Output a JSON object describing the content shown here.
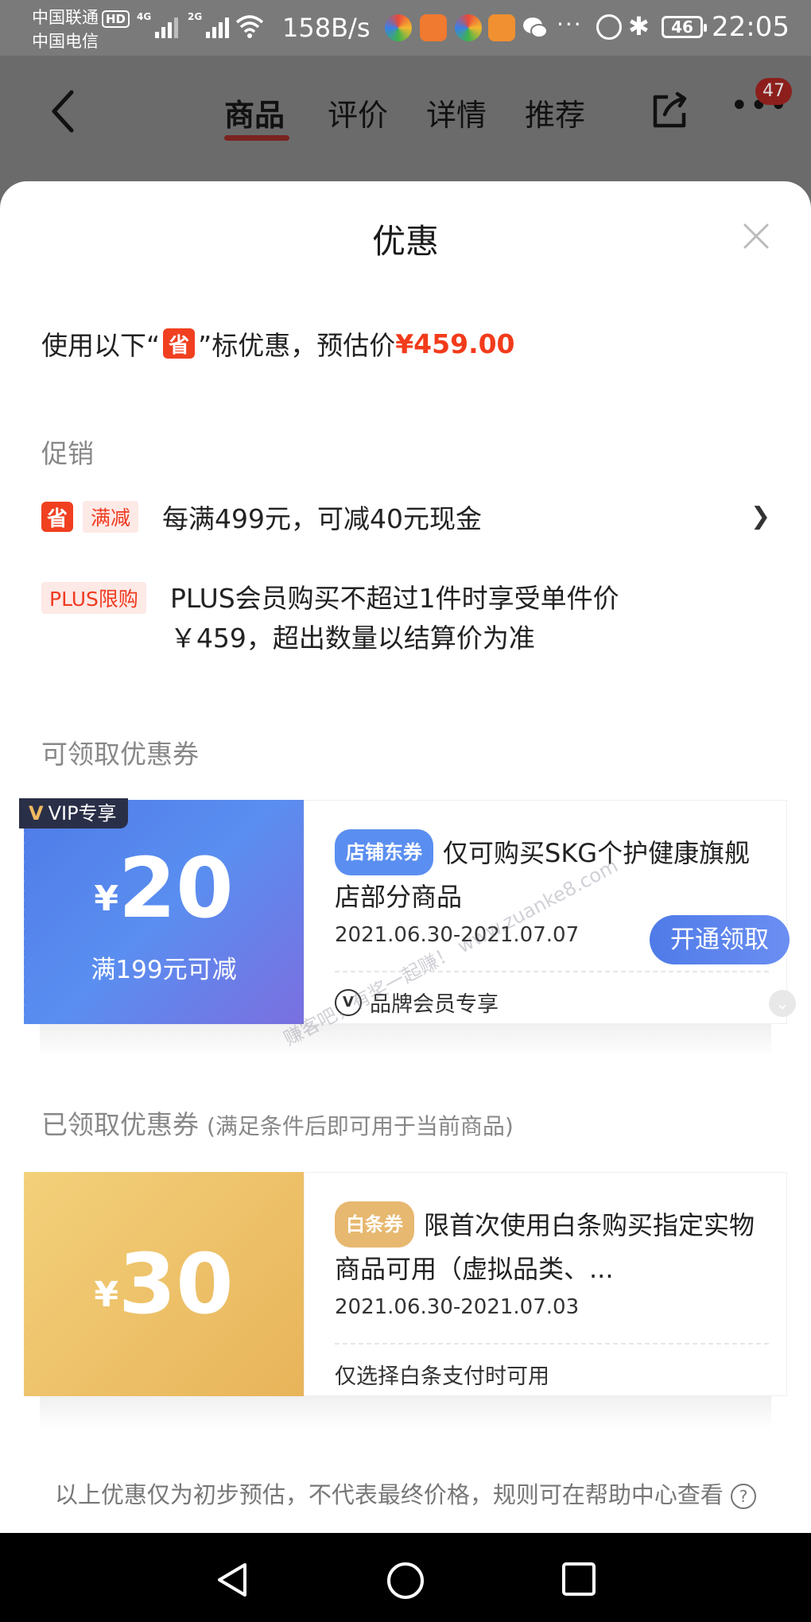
{
  "status_bar": {
    "carrier1": "中国联通",
    "hd": "HD",
    "carrier2": "中国电信",
    "net1": "4G",
    "net2": "2G",
    "speed": "158B/s",
    "battery": "46",
    "time": "22:05"
  },
  "header": {
    "tabs": [
      {
        "label": "商品",
        "active": true
      },
      {
        "label": "评价"
      },
      {
        "label": "详情"
      },
      {
        "label": "推荐"
      }
    ],
    "badge_count": "47"
  },
  "sheet": {
    "title": "优惠",
    "summary": {
      "prefix": "使用以下“",
      "icon_text": "省",
      "suffix": "”标优惠，预估价",
      "price": "¥459.00"
    },
    "promotion_section": "促销",
    "promotions": [
      {
        "icon": "省",
        "tag": "满减",
        "text": "每满499元，可减40元现金"
      },
      {
        "tag": "PLUS限购",
        "text_line1": "PLUS会员购买不超过1件时享受单件价",
        "text_line2": "￥459，超出数量以结算价为准"
      }
    ],
    "available_section": "可领取优惠券",
    "available_coupon": {
      "vip_label": "VIP专享",
      "currency": "¥",
      "amount": "20",
      "condition": "满199元可减",
      "type_tag": "店铺东券",
      "description": "仅可购买SKG个护健康旗舰店部分商品",
      "date_range": "2021.06.30-2021.07.07",
      "claim_button": "开通领取",
      "footer": "品牌会员专享"
    },
    "received_section": "已领取优惠券",
    "received_note": "(满足条件后即可用于当前商品)",
    "received_coupon": {
      "currency": "¥",
      "amount": "30",
      "type_tag": "白条券",
      "description": "限首次使用白条购买指定实物商品可用（虚拟品类、...",
      "date_range": "2021.06.30-2021.07.03",
      "footer": "仅选择白条支付时可用"
    },
    "disclaimer": "以上优惠仅为初步预估，不代表最终价格，规则可在帮助中心查看"
  },
  "watermark": "赚客吧，有奖一起赚！ www.zuanke8.com",
  "colors": {
    "accent_red": "#f23b1b",
    "coupon_blue": "#5a8ef0",
    "coupon_gold": "#e8b45a"
  }
}
